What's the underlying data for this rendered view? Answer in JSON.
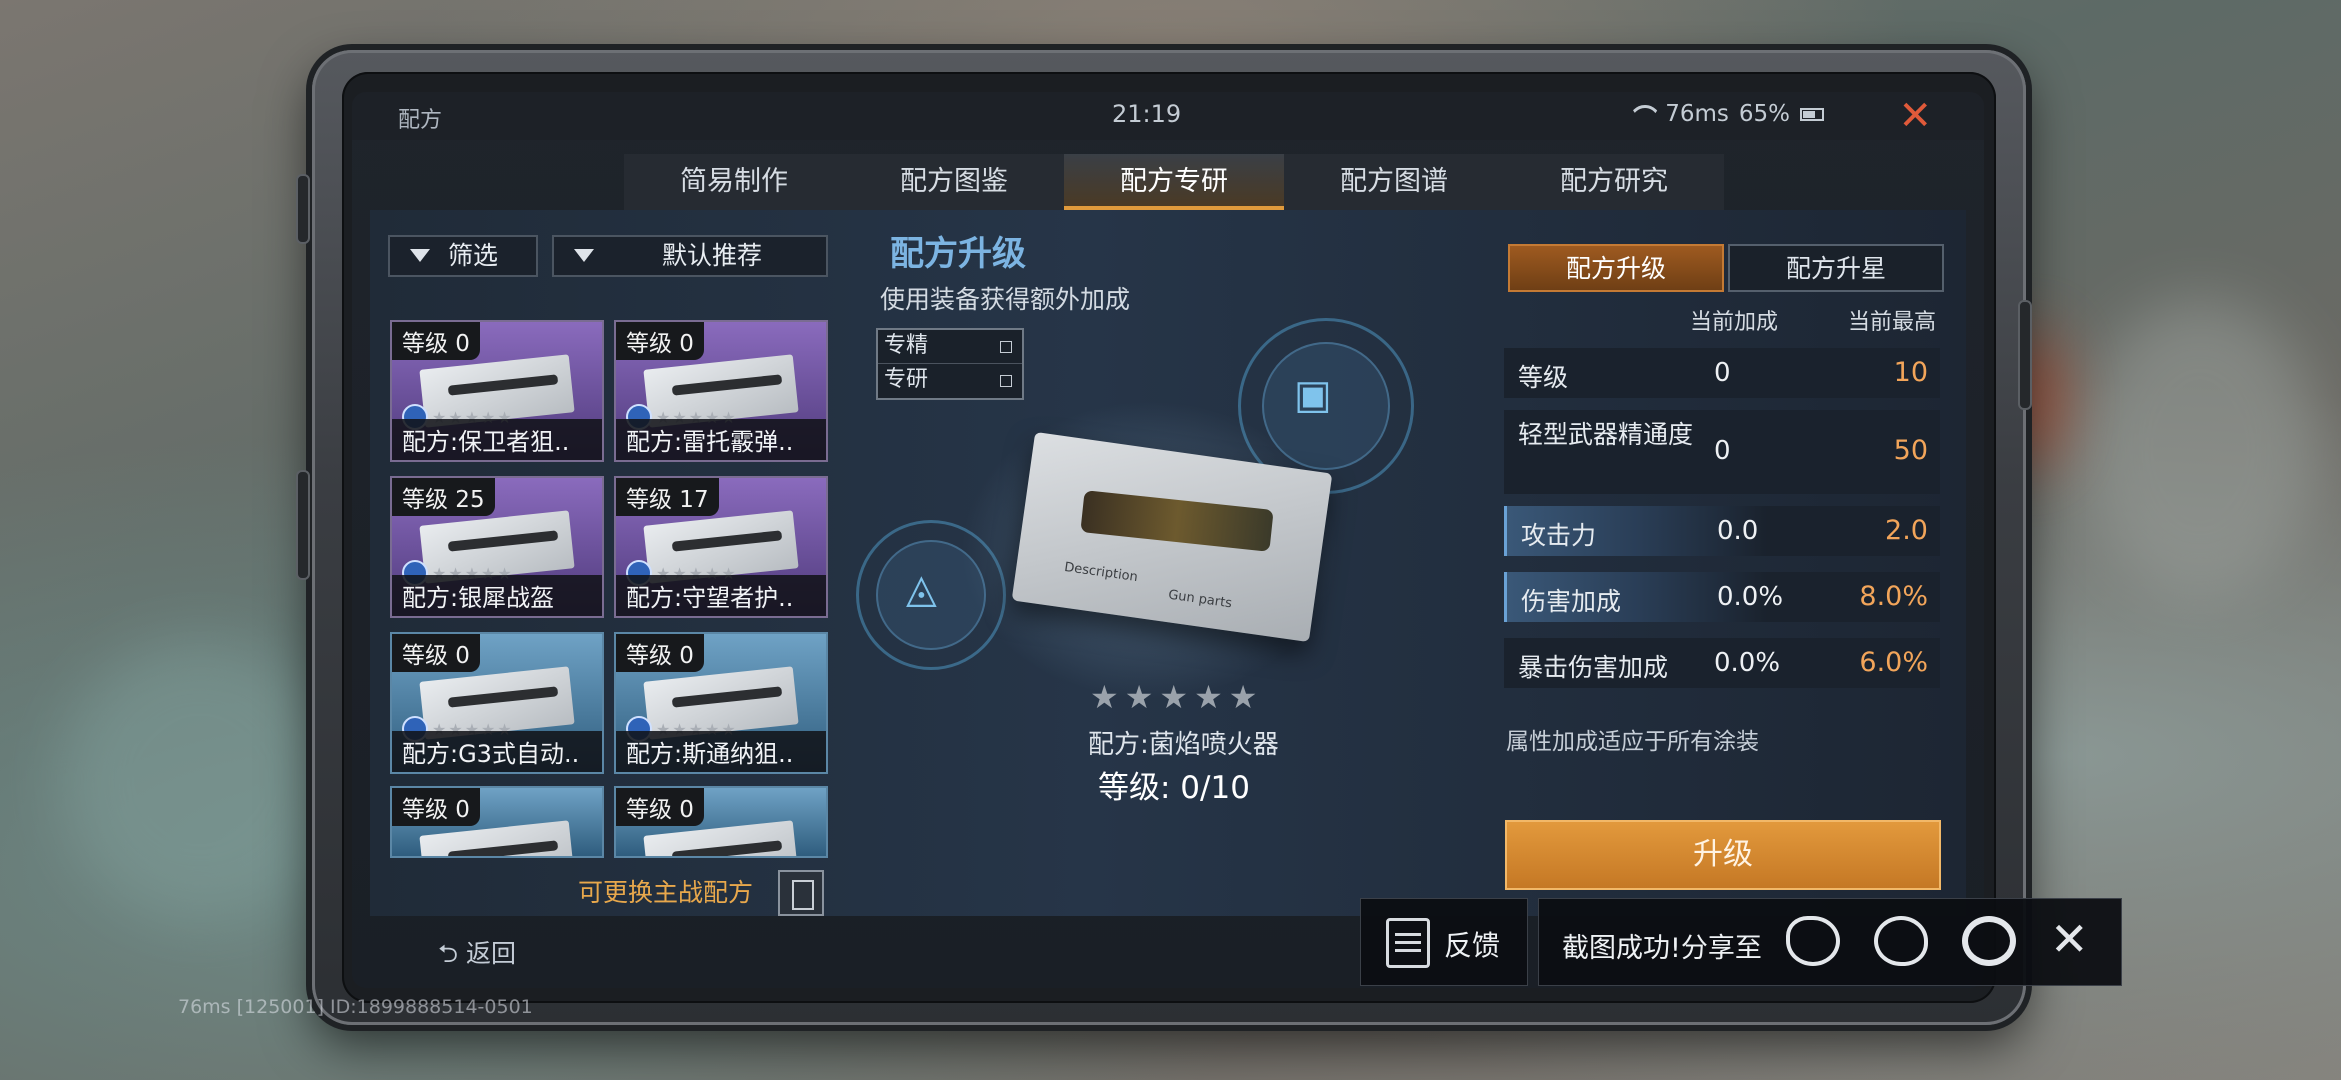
{
  "topbar": {
    "title": "配方",
    "time": "21:19",
    "ping": "76ms",
    "battery": "65%",
    "close_icon": "close-icon"
  },
  "tabs": [
    "简易制作",
    "配方图鉴",
    "配方专研",
    "配方图谱",
    "配方研究"
  ],
  "active_tab": 2,
  "left": {
    "filter_label": "筛选",
    "sort_label": "默认推荐",
    "cards": [
      {
        "level": "等级 0",
        "name": "配方:保卫者狙..",
        "color": "purple"
      },
      {
        "level": "等级 0",
        "name": "配方:雷托霰弹..",
        "color": "purple"
      },
      {
        "level": "等级 25",
        "name": "配方:银犀战盔",
        "color": "purple"
      },
      {
        "level": "等级 17",
        "name": "配方:守望者护..",
        "color": "purple"
      },
      {
        "level": "等级 0",
        "name": "配方:G3式自动..",
        "color": "blue"
      },
      {
        "level": "等级 0",
        "name": "配方:斯通纳狙..",
        "color": "blue"
      },
      {
        "level": "等级 0",
        "name": "",
        "color": "blue"
      },
      {
        "level": "等级 0",
        "name": "",
        "color": "blue"
      }
    ],
    "swap_label": "可更换主战配方",
    "back_label": "返回"
  },
  "middle": {
    "title": "配方升级",
    "subtitle": "使用装备获得额外加成",
    "checkboxes": [
      "专精",
      "专研"
    ],
    "blueprint_text1": "Description",
    "blueprint_text2": "Gun parts",
    "stars": "★★★★★",
    "recipe_name": "配方:菌焰喷火器",
    "recipe_level": "等级: 0/10"
  },
  "right": {
    "tab_upgrade": "配方升级",
    "tab_star": "配方升星",
    "col_current": "当前加成",
    "col_max": "当前最高",
    "stats": [
      {
        "label": "等级",
        "current": "0",
        "max": "10"
      },
      {
        "label": "轻型武器精通度",
        "current": "0",
        "max": "50"
      },
      {
        "label": "攻击力",
        "current": "0.0",
        "max": "2.0"
      },
      {
        "label": "伤害加成",
        "current": "0.0%",
        "max": "8.0%"
      },
      {
        "label": "暴击伤害加成",
        "current": "0.0%",
        "max": "6.0%"
      }
    ],
    "note": "属性加成适应于所有涂装",
    "upgrade_label": "升级"
  },
  "overlay": {
    "feedback_label": "反馈",
    "share_label": "截图成功!分享至",
    "icons": [
      "weibo-icon",
      "wechat-icon",
      "moments-icon"
    ]
  },
  "debug": "76ms  [125001] ID:1899888514-0501",
  "colors": {
    "accent": "#e09a3c",
    "title_blue": "#7cb4e2",
    "max_orange": "#f2a55a"
  }
}
